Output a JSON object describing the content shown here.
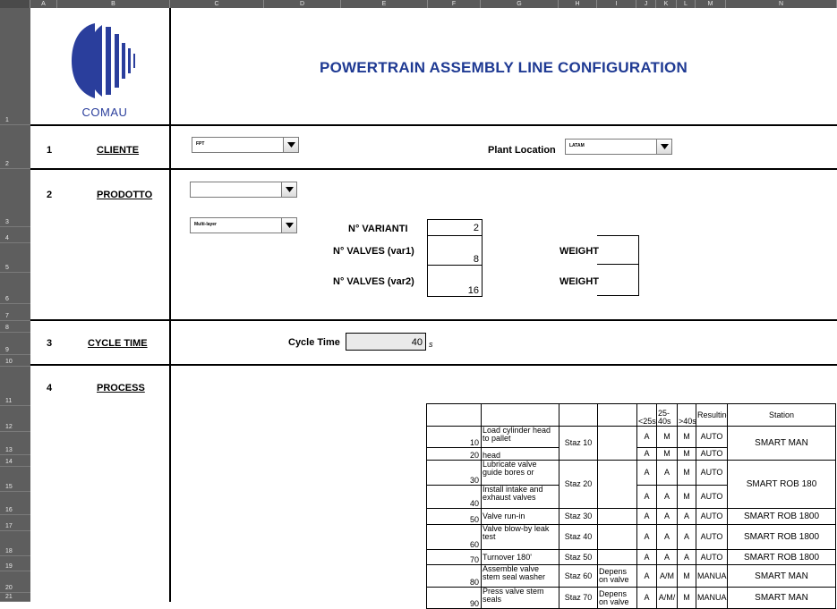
{
  "sheet": {
    "column_headers": [
      "A",
      "B",
      "C",
      "D",
      "E",
      "F",
      "G",
      "H",
      "I",
      "J",
      "K",
      "L",
      "M",
      "N"
    ],
    "row_headers": [
      "1",
      "2",
      "3",
      "4",
      "5",
      "6",
      "7",
      "8",
      "9",
      "10",
      "11",
      "12",
      "13",
      "14",
      "15",
      "16",
      "17",
      "18",
      "19",
      "20",
      "21"
    ]
  },
  "logo": {
    "icon": "comau-logo",
    "text": "COMAU"
  },
  "title": "POWERTRAIN ASSEMBLY LINE  CONFIGURATION",
  "sections": {
    "s1": {
      "num": "1",
      "label": "CLIENTE",
      "client_value": "FPT",
      "plant_label": "Plant Location",
      "plant_value": "LATAM"
    },
    "s2": {
      "num": "2",
      "label": "PRODOTTO",
      "product_value": "",
      "type_value": "Multi-layer",
      "varianti_label": "N° VARIANTI",
      "varianti_value": "2",
      "valves1_label": "N° VALVES (var1)",
      "valves1_value": "8",
      "valves2_label": "N° VALVES (var2)",
      "valves2_value": "16",
      "weight1_label": "WEIGHT",
      "weight2_label": "WEIGHT"
    },
    "s3": {
      "num": "3",
      "label": "CYCLE TIME",
      "ct_label": "Cycle Time",
      "ct_value": "40",
      "ct_unit": "s"
    },
    "s4": {
      "num": "4",
      "label": "PROCESS"
    }
  },
  "process": {
    "headers": {
      "lt25": "<25s",
      "mid": "25-40s",
      "gt40": ">40s",
      "resulting": "Resulting",
      "station": "Station"
    },
    "rows": [
      {
        "n": "10",
        "desc": "Load cylinder head to pallet",
        "a": "A",
        "b": "M",
        "c": "M",
        "res": "AUTO"
      },
      {
        "n": "20",
        "desc": "Inspect cylinder head",
        "a": "A",
        "b": "M",
        "c": "M",
        "res": "AUTO"
      },
      {
        "n": "30",
        "desc": "Lubricate valve guide bores or",
        "a": "A",
        "b": "A",
        "c": "M",
        "res": "AUTO"
      },
      {
        "n": "40",
        "desc": "Install intake and exhaust valves",
        "a": "A",
        "b": "A",
        "c": "M",
        "res": "AUTO"
      },
      {
        "n": "50",
        "desc": "Valve run-in",
        "staz": "Staz 30",
        "a": "A",
        "b": "A",
        "c": "A",
        "res": "AUTO",
        "station": "SMART ROB 1800"
      },
      {
        "n": "60",
        "desc": "Valve blow-by leak test",
        "staz": "Staz 40",
        "a": "A",
        "b": "A",
        "c": "A",
        "res": "AUTO",
        "station": "SMART ROB 1800"
      },
      {
        "n": "70",
        "desc": "Turnover 180'",
        "staz": "Staz 50",
        "a": "A",
        "b": "A",
        "c": "A",
        "res": "AUTO",
        "station": "SMART ROB 1800"
      },
      {
        "n": "80",
        "desc": "Assemble valve stem seal washer",
        "staz": "Staz 60",
        "dep": "Depens on valve",
        "a": "A",
        "b": "A/M",
        "c": "M",
        "res": "MANUAL",
        "station": "SMART MAN"
      },
      {
        "n": "90",
        "desc": "Press valve stem seals",
        "staz": "Staz 70",
        "dep": "Depens on valve",
        "a": "A",
        "b": "A/M/",
        "c": "M",
        "res": "MANUAL",
        "station": "SMART MAN"
      }
    ],
    "groups": {
      "g1": {
        "staz": "Staz 10",
        "station": "SMART MAN"
      },
      "g2": {
        "staz": "Staz 20",
        "station": "SMART ROB 180"
      }
    }
  }
}
